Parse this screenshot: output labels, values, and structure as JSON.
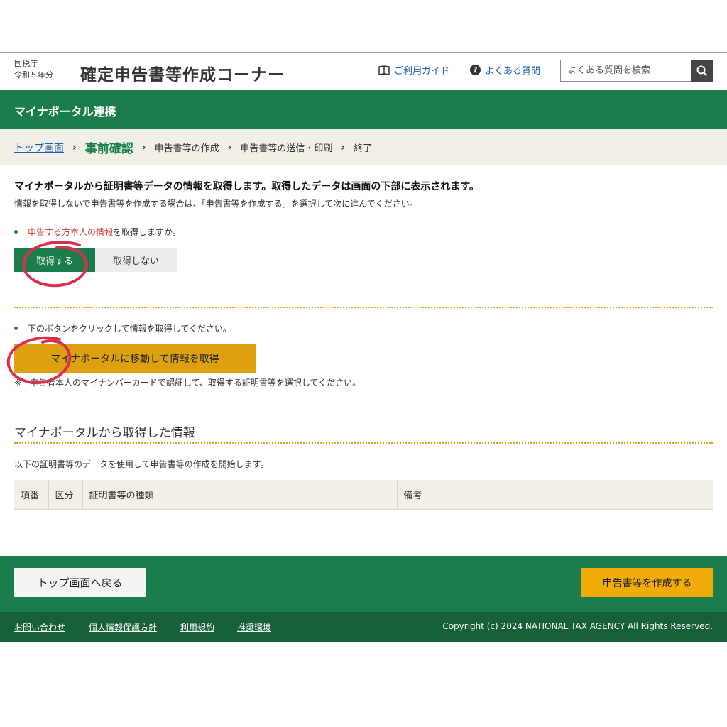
{
  "header": {
    "agency_line1": "国税庁",
    "agency_line2": "令和５年分",
    "title": "確定申告書等作成コーナー",
    "guide_link": "ご利用ガイド",
    "faq_icon": "?",
    "faq_link": "よくある質問",
    "search_placeholder": "よくある質問を検索",
    "icons": {
      "guide": "book-icon",
      "faq": "question-icon",
      "search": "search-icon"
    }
  },
  "section": {
    "title": "マイナポータル連携"
  },
  "breadcrumb": {
    "items": [
      "トップ画面",
      "事前確認",
      "申告書等の作成",
      "申告書等の送信・印刷",
      "終了"
    ],
    "separator": "›"
  },
  "intro": {
    "bold": "マイナポータルから証明書等データの情報を取得します。取得したデータは画面の下部に表示されます。",
    "sub": "情報を取得しないで申告書等を作成する場合は、「申告書等を作成する」を選択して次に進んでください。"
  },
  "question1": {
    "highlight": "申告する方本人の情報",
    "rest": "を取得しますか。",
    "yes_label": "取得する",
    "no_label": "取得しない",
    "selected": "取得する"
  },
  "question2": {
    "text": "下のボタンをクリックして情報を取得してください。",
    "button_label": "マイナポータルに移動して情報を取得",
    "note": "※　申告者本人のマイナンバーカードで認証して、取得する証明書等を選択してください。"
  },
  "acquired": {
    "heading": "マイナポータルから取得した情報",
    "description": "以下の証明書等のデータを使用して申告書等の作成を開始します。",
    "table_headers": [
      "項番",
      "区分",
      "証明書等の種類",
      "備考"
    ],
    "rows": []
  },
  "footer": {
    "back_label": "トップ画面へ戻る",
    "create_label": "申告書等を作成する",
    "links": [
      "お問い合わせ",
      "個人情報保護方針",
      "利用規約",
      "推奨環境"
    ],
    "copyright": "Copyright (c) 2024 NATIONAL TAX AGENCY All Rights Reserved."
  },
  "colors": {
    "brand_green": "#1a7d4b",
    "dark_green": "#15603a",
    "action_yellow": "#f2ac0a",
    "highlight_red": "#d0312d",
    "annotation_red": "#d9304f",
    "breadcrumb_bg": "#f1efe6"
  }
}
